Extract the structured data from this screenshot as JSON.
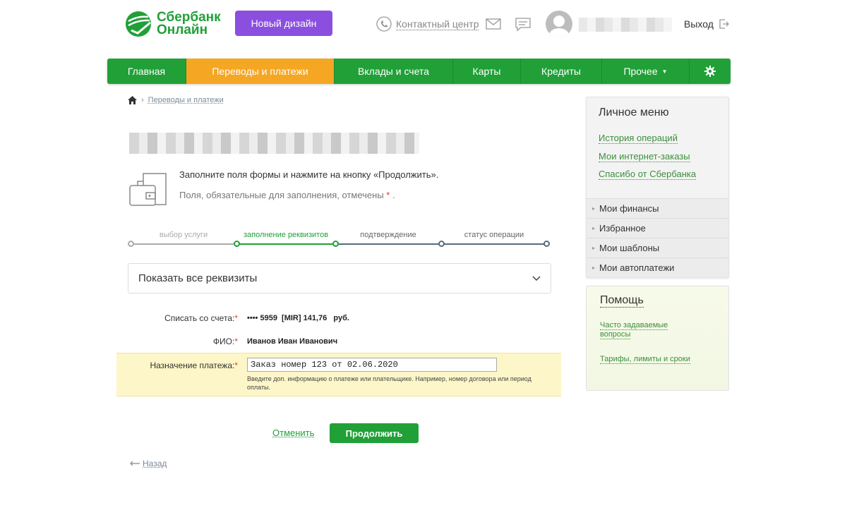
{
  "header": {
    "logo_line1": "Сбербанк",
    "logo_line2": "Онлайн",
    "new_design_button": "Новый дизайн",
    "contact_center": "Контактный центр",
    "logout": "Выход",
    "icons": [
      "phone-icon",
      "mail-icon",
      "chat-icon",
      "avatar-icon",
      "logout-icon"
    ]
  },
  "nav": {
    "items": [
      {
        "label": "Главная"
      },
      {
        "label": "Переводы и платежи",
        "active": true
      },
      {
        "label": "Вклады и счета"
      },
      {
        "label": "Карты"
      },
      {
        "label": "Кредиты"
      },
      {
        "label": "Прочее"
      }
    ],
    "settings_icon": "gear-icon"
  },
  "breadcrumb": {
    "home_icon": "home-icon",
    "link": "Переводы и платежи"
  },
  "form": {
    "hint_main": "Заполните поля формы и нажмите на кнопку «Продолжить».",
    "hint_required_prefix": "Поля, обязательные для заполнения, отмечены",
    "hint_required_mark": "*",
    "hint_required_suffix": ".",
    "steps": [
      {
        "label": "выбор услуги"
      },
      {
        "label": "заполнение реквизитов",
        "current": true
      },
      {
        "label": "подтверждение"
      },
      {
        "label": "статус операции"
      }
    ],
    "show_all_details": "Показать все реквизиты",
    "account_label": "Списать со счета:",
    "account_value": "•••• 5959  [MIR] 141,76   руб.",
    "name_label": "ФИО:",
    "name_value": "Иванов Иван Иванович",
    "purpose_label": "Назначение платежа:",
    "purpose_value": "Заказ номер 123 от 02.06.2020",
    "purpose_help": "Введите доп. информацию о платеже или плательщике. Например, номер договора или период оплаты.",
    "required_mark": "*",
    "cancel": "Отменить",
    "continue": "Продолжить",
    "back": "Назад"
  },
  "personal_menu": {
    "title": "Личное меню",
    "links": [
      "История операций",
      "Мои интернет-заказы",
      "Спасибо от Сбербанка"
    ],
    "sections": [
      "Мои финансы",
      "Избранное",
      "Мои шаблоны",
      "Мои автоплатежи"
    ]
  },
  "help": {
    "title": "Помощь",
    "links": [
      "Часто задаваемые вопросы",
      "Тарифы, лимиты и сроки"
    ]
  },
  "colors": {
    "brand_green": "#21a038",
    "active_tab_orange": "#f5a623",
    "new_design_purple": "#8b4fe0",
    "highlight_yellow": "#fdf6c8",
    "stepper_dark": "#5a6b7a"
  }
}
